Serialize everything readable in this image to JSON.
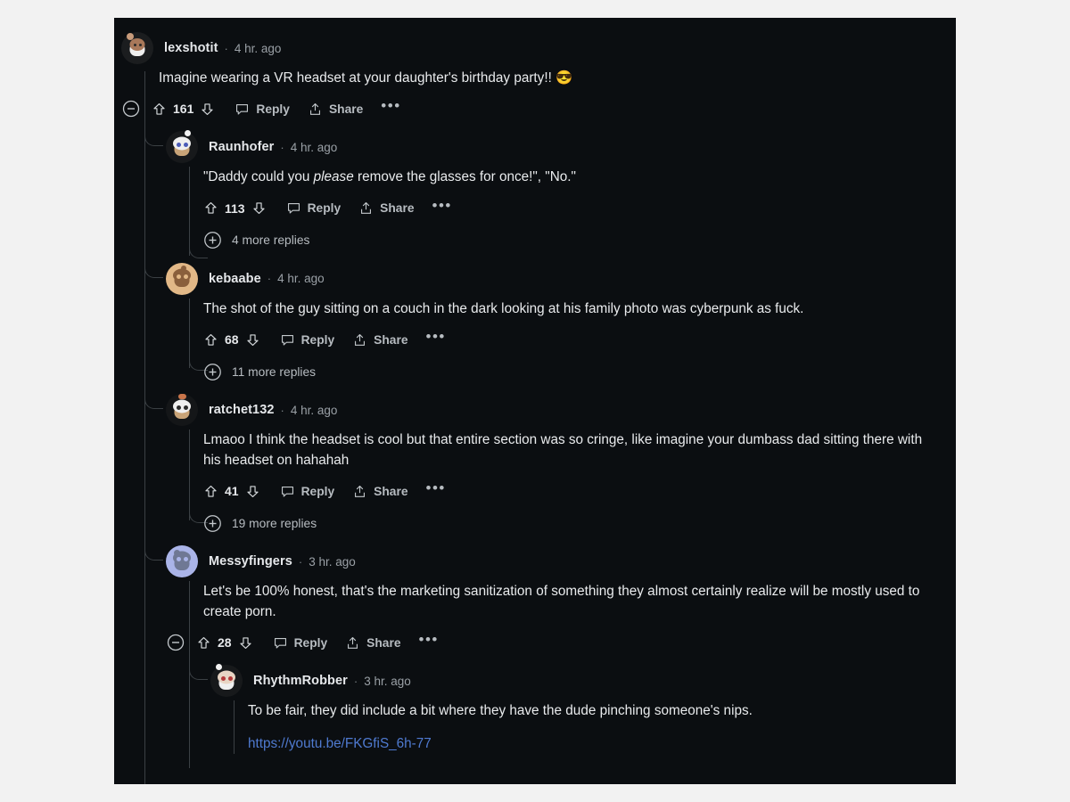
{
  "theme": {
    "page_background": "#f2f2f2",
    "card_background": "#0b0e11",
    "text_primary": "#e9ebed",
    "text_secondary": "#b7bcc1",
    "text_muted": "#9aa0a6",
    "thread_line": "#3b4044",
    "link_color": "#4f7ad0"
  },
  "labels": {
    "reply": "Reply",
    "share": "Share",
    "separator": "·",
    "overflow": "•••"
  },
  "comments": [
    {
      "id": "c0",
      "depth": 0,
      "username": "lexshotit",
      "age": "4 hr. ago",
      "body": "Imagine wearing a VR headset at your daughter's birthday party!! 😎",
      "votes": "161",
      "collapsible": true,
      "avatar": {
        "name": "astronaut-snoo-avatar",
        "bg": "#1b1d1f",
        "body": "#efefef",
        "head": "#a8785a"
      },
      "more_replies": null
    },
    {
      "id": "c1",
      "depth": 1,
      "username": "Raunhofer",
      "age": "4 hr. ago",
      "body_pre": "\"Daddy could you ",
      "body_em": "please",
      "body_post": " remove the glasses for once!\", \"No.\"",
      "votes": "113",
      "collapsible": false,
      "avatar": {
        "name": "chef-snoo-avatar",
        "bg": "#17191b",
        "body": "#d8cdb6",
        "head": "#efefef"
      },
      "more_replies": "4 more replies"
    },
    {
      "id": "c2",
      "depth": 1,
      "username": "kebaabe",
      "age": "4 hr. ago",
      "body": "The shot of the guy sitting on a couch in the dark looking at his family photo was cyberpunk as fuck.",
      "votes": "68",
      "collapsible": false,
      "avatar": {
        "name": "tan-snoo-avatar",
        "bg": "#e2b887",
        "body": "#8a5f3c",
        "head": "#8a5f3c"
      },
      "more_replies": "11 more replies"
    },
    {
      "id": "c3",
      "depth": 1,
      "username": "ratchet132",
      "age": "4 hr. ago",
      "body": "Lmaoo I think the headset is cool but that entire section was so cringe, like imagine your dumbass dad sitting there with his headset on hahahah",
      "votes": "41",
      "collapsible": false,
      "avatar": {
        "name": "panda-snoo-avatar",
        "bg": "#141618",
        "body": "#c9a478",
        "head": "#efefef"
      },
      "more_replies": "19 more replies"
    },
    {
      "id": "c4",
      "depth": 1,
      "username": "Messyfingers",
      "age": "3 hr. ago",
      "body": "Let's be 100% honest, that's the marketing sanitization of something they almost certainly realize will be mostly used to create porn.",
      "votes": "28",
      "collapsible": true,
      "avatar": {
        "name": "blue-snoo-avatar",
        "bg": "#aab4e8",
        "body": "#6f7894",
        "head": "#6f7894"
      },
      "more_replies": null
    },
    {
      "id": "c5",
      "depth": 2,
      "username": "RhythmRobber",
      "age": "3 hr. ago",
      "body": "To be fair, they did include a bit where they have the dude pinching someone's nips.",
      "link": "https://youtu.be/FKGfiS_6h-77",
      "votes": null,
      "collapsible": false,
      "avatar": {
        "name": "suit-snoo-avatar",
        "bg": "#17191b",
        "body": "#efefef",
        "head": "#e8d5c4"
      },
      "more_replies": null
    }
  ]
}
